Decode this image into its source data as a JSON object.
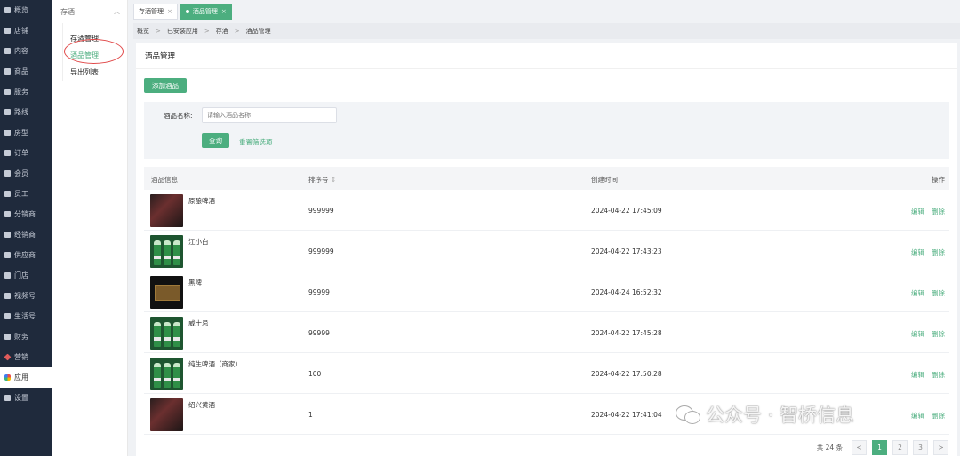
{
  "nav": {
    "items": [
      {
        "label": "概览",
        "icon": "monitor-icon"
      },
      {
        "label": "店铺",
        "icon": "home-icon"
      },
      {
        "label": "内容",
        "icon": "layers-icon"
      },
      {
        "label": "商品",
        "icon": "bag-icon"
      },
      {
        "label": "服务",
        "icon": "heart-icon"
      },
      {
        "label": "路线",
        "icon": "route-icon"
      },
      {
        "label": "房型",
        "icon": "door-icon"
      },
      {
        "label": "订单",
        "icon": "order-icon"
      },
      {
        "label": "会员",
        "icon": "user-icon"
      },
      {
        "label": "员工",
        "icon": "staff-icon"
      },
      {
        "label": "分销商",
        "icon": "distributor-icon"
      },
      {
        "label": "经销商",
        "icon": "dealer-icon"
      },
      {
        "label": "供应商",
        "icon": "supplier-icon"
      },
      {
        "label": "门店",
        "icon": "store-icon"
      },
      {
        "label": "视频号",
        "icon": "video-icon"
      },
      {
        "label": "生活号",
        "icon": "life-icon"
      },
      {
        "label": "财务",
        "icon": "finance-icon"
      },
      {
        "label": "营销",
        "icon": "marketing-icon"
      },
      {
        "label": "应用",
        "icon": "apps-icon"
      },
      {
        "label": "设置",
        "icon": "gear-icon"
      }
    ]
  },
  "subnav": {
    "title": "存酒",
    "items": [
      "存酒管理",
      "酒品管理",
      "导出列表"
    ]
  },
  "tabs": {
    "tab1": "存酒管理",
    "tab2": "酒品管理",
    "close": "×"
  },
  "breadcrumb": {
    "b1": "概览",
    "b2": "已安装应用",
    "b3": "存酒",
    "b4": "酒品管理",
    "sep": ">"
  },
  "page": {
    "title": "酒品管理",
    "add_button": "添加酒品"
  },
  "filter": {
    "label": "酒品名称:",
    "placeholder": "请输入酒品名称",
    "query_button": "查询",
    "reset_link": "重置筛选项"
  },
  "table": {
    "headers": {
      "info": "酒品信息",
      "sort": "排序号",
      "created": "创建时间",
      "ops": "操作"
    },
    "edit": "编辑",
    "delete": "删除",
    "rows": [
      {
        "name": "原酿啤酒",
        "sort": "999999",
        "time": "2024-04-22 17:45:09",
        "thumb": "dark"
      },
      {
        "name": "江小白",
        "sort": "999999",
        "time": "2024-04-22 17:43:23",
        "thumb": "green"
      },
      {
        "name": "黑啤",
        "sort": "99999",
        "time": "2024-04-24 16:52:32",
        "thumb": "black"
      },
      {
        "name": "威士忌",
        "sort": "99999",
        "time": "2024-04-22 17:45:28",
        "thumb": "green"
      },
      {
        "name": "纯生啤酒（商家）",
        "sort": "100",
        "time": "2024-04-22 17:50:28",
        "thumb": "green"
      },
      {
        "name": "绍兴黄酒",
        "sort": "1",
        "time": "2024-04-22 17:41:04",
        "thumb": "dark"
      }
    ]
  },
  "pager": {
    "total": "共 24 条",
    "prev": "<",
    "p1": "1",
    "p2": "2",
    "p3": "3",
    "next": ">"
  },
  "watermark": {
    "text": "公众号 · 智桥信息"
  },
  "colors": {
    "accent": "#4cae7f",
    "nav_bg": "#1f2a3c",
    "highlight_circle": "#e04848"
  }
}
